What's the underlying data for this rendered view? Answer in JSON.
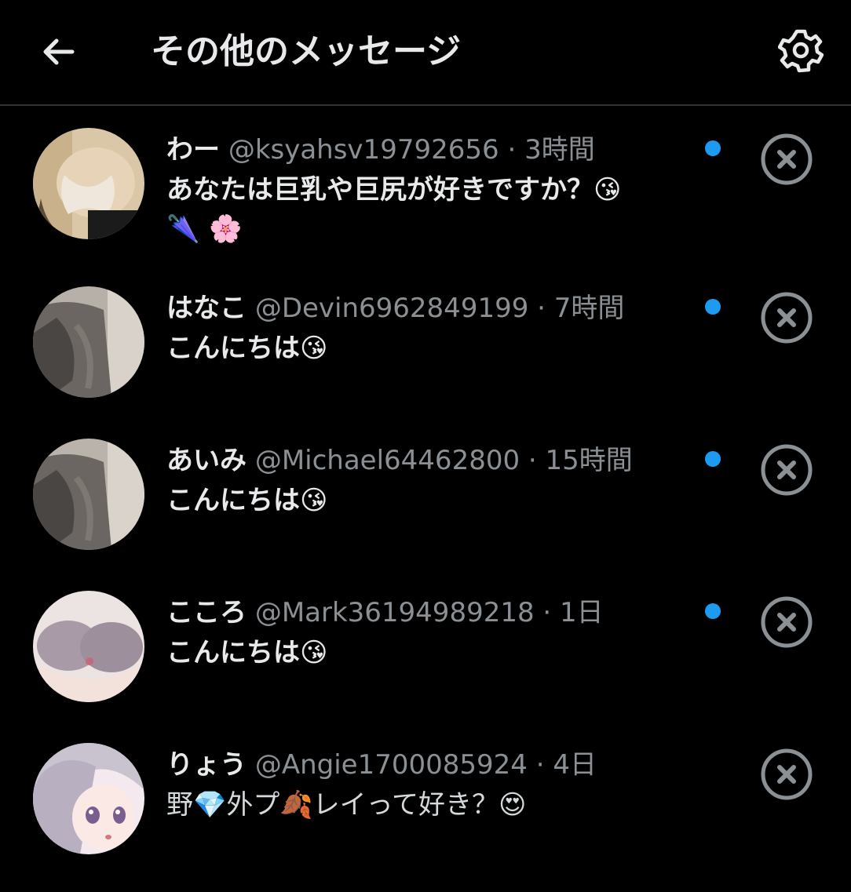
{
  "header": {
    "title": "その他のメッセージ",
    "back_icon": "arrow-left-icon",
    "settings_icon": "gear-icon"
  },
  "colors": {
    "background": "#000000",
    "primary_text": "#e7e9ea",
    "secondary_text": "#8b9095",
    "unread_dot": "#1d9bf0",
    "divider": "#2f3336"
  },
  "messages": [
    {
      "name": "わー",
      "handle": "@ksyahsv19792656",
      "separator": "·",
      "time": "3時間",
      "text_line1": "あなたは巨乳や巨尻が好きですか？😘",
      "text_line2": "🌂 🌸",
      "unread": true,
      "close_icon": "close-circle-icon"
    },
    {
      "name": "はなこ",
      "handle": "@Devin6962849199",
      "separator": "·",
      "time": "7時間",
      "text_line1": "こんにちは😘",
      "unread": true,
      "close_icon": "close-circle-icon"
    },
    {
      "name": "あいみ",
      "handle": "@Michael64462800",
      "separator": "·",
      "time": "15時間",
      "text_line1": "こんにちは😘",
      "unread": true,
      "close_icon": "close-circle-icon"
    },
    {
      "name": "こころ",
      "handle": "@Mark36194989218",
      "separator": "·",
      "time": "1日",
      "text_line1": "こんにちは😘",
      "unread": true,
      "close_icon": "close-circle-icon"
    },
    {
      "name": "りょう",
      "handle": "@Angie1700085924",
      "separator": "·",
      "time": "4日",
      "text_line1": "野💎外プ🍂レイって好き？😍",
      "unread": false,
      "close_icon": "close-circle-icon"
    }
  ]
}
